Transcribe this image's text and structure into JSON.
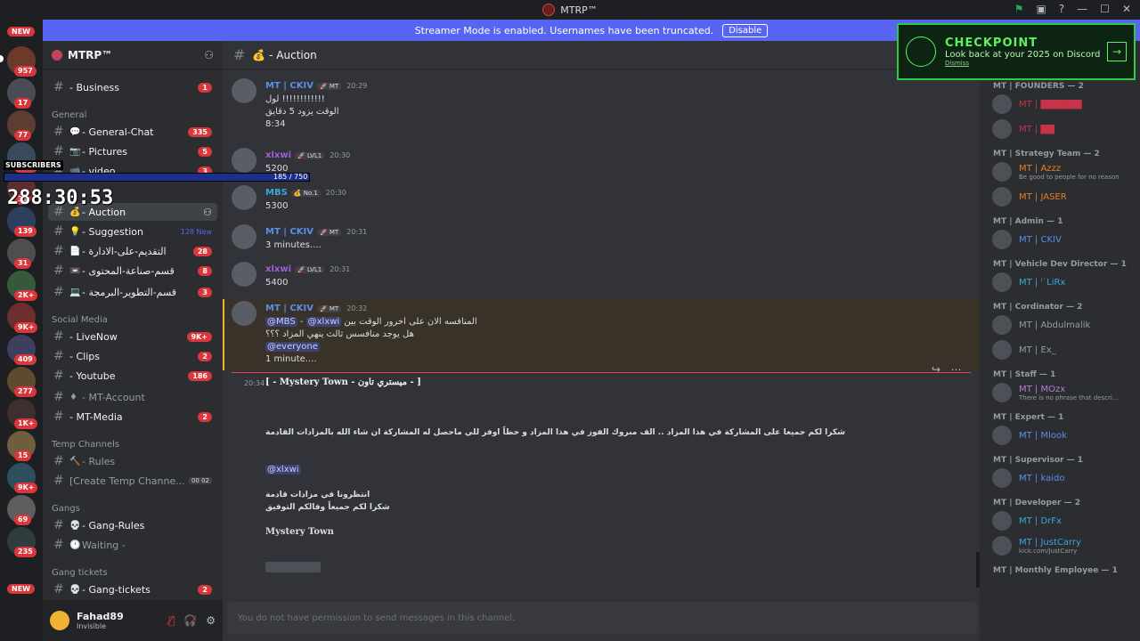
{
  "app_title": "MTRP™",
  "streamer_banner": {
    "text": "Streamer Mode is enabled. Usernames have been truncated.",
    "button": "Disable"
  },
  "server": {
    "name": "MTRP™"
  },
  "server_rail": {
    "top_new": "NEW",
    "badges": [
      "957",
      "17",
      "77",
      "1K+",
      "39",
      "139",
      "31",
      "2K+",
      "9K+",
      "409",
      "277",
      "1K+",
      "15",
      "9K+",
      "69",
      "235"
    ],
    "bottom_new": "NEW"
  },
  "categories": {
    "general": "General",
    "social": "Social Media",
    "temp": "Temp Channels",
    "gangs": "Gangs",
    "gang_tickets": "Gang tickets"
  },
  "channels": [
    {
      "name": "- Business",
      "badge": "1",
      "emoji": "",
      "bright": true
    },
    {
      "name": "- General-Chat",
      "badge": "335",
      "emoji": "💬",
      "bright": true
    },
    {
      "name": "- Pictures",
      "badge": "5",
      "emoji": "📷",
      "bright": true
    },
    {
      "name": "- video",
      "badge": "3",
      "emoji": "📹",
      "bright": true
    },
    {
      "name": "- Auction",
      "badge": "",
      "emoji": "💰",
      "active": true
    },
    {
      "name": "- Suggestion",
      "badge": "",
      "newtag": "128 New",
      "emoji": "💡",
      "bright": true
    },
    {
      "name": "- التقديم-على-الادارة",
      "badge": "28",
      "emoji": "📄",
      "bright": true
    },
    {
      "name": "- قسم-صناعة-المحتوى",
      "badge": "8",
      "emoji": "📼",
      "bright": true
    },
    {
      "name": "- قسم-التطوير-البرمجة",
      "badge": "3",
      "emoji": "💻",
      "bright": true
    },
    {
      "name": "- LiveNow",
      "badge": "9K+",
      "emoji": "",
      "bright": true
    },
    {
      "name": "- Clips",
      "badge": "2",
      "emoji": "",
      "bright": true
    },
    {
      "name": "- Youtube",
      "badge": "186",
      "emoji": "",
      "bright": true
    },
    {
      "name": "- MT-Account",
      "badge": "",
      "emoji": "♦",
      "bright": false
    },
    {
      "name": "- MT-Media",
      "badge": "2",
      "emoji": "",
      "bright": true
    },
    {
      "name": "- Rules",
      "badge": "",
      "emoji": "🔨",
      "bright": false
    },
    {
      "name": "[Create Temp Channe...",
      "badge": "",
      "emoji": "",
      "bright": false,
      "extra": "00 02"
    },
    {
      "name": "- Gang-Rules",
      "badge": "",
      "emoji": "💀",
      "bright": true
    },
    {
      "name": "Waiting -",
      "badge": "",
      "emoji": "🕐",
      "bright": false
    },
    {
      "name": "- Gang-tickets",
      "badge": "2",
      "emoji": "💀",
      "bright": true
    }
  ],
  "user": {
    "name": "Fahad89",
    "status": "Invisible"
  },
  "channel_header": {
    "name": "💰 - Auction"
  },
  "messages": [
    {
      "author": "MT | CKIV",
      "tag": "🚀 MT",
      "time": "20:29",
      "lines": [
        "لول !!!!!!!!!!!!",
        "الوقت يزود 5 دقايق",
        "8:34"
      ],
      "color": "#5c8ee8"
    },
    {
      "author": "xlxwi",
      "tag": "🚀 LVL1",
      "time": "20:30",
      "lines": [
        "5200"
      ],
      "color": "#a35ed8"
    },
    {
      "author": "MBS",
      "tag": "💰 No.1",
      "time": "20:30",
      "lines": [
        "5300"
      ],
      "color": "#3aa7d8"
    },
    {
      "author": "MT | CKIV",
      "tag": "🚀 MT",
      "time": "20:31",
      "lines": [
        "3 minutes...."
      ],
      "color": "#5c8ee8"
    },
    {
      "author": "xlxwi",
      "tag": "🚀 LVL1",
      "time": "20:31",
      "lines": [
        "5400"
      ],
      "color": "#a35ed8"
    },
    {
      "author": "MT | CKIV",
      "tag": "🚀 MT",
      "time": "20:32",
      "lines": [
        "المنافسه الان على اخرور الوقت بين",
        "هل يوجد منافسس ثالث ينهي المزاد ؟؟؟",
        "1 minute...."
      ],
      "mentions": [
        "@MBS",
        "@xlxwi",
        "@everyone"
      ],
      "color": "#5c8ee8"
    }
  ],
  "bot_message": {
    "time": "20:34",
    "title": "[ - Mystery Town - ميستري تاون - ]",
    "body": "شكرا لكم جميعا على المشاركة في هذا المزاد .. الف مبروك الفوز في هذا المزاد  و حظاً اوفر للي ماحصل له المشاركة ان شاء الله بالمزادات القادمة",
    "mention": "@xlxwi",
    "line1": "انتظرونا في مزادات قادمة",
    "line2": "شكرا لكم جميعاً وفالكم التوفيق",
    "sign": "Mystery Town"
  },
  "composer_placeholder": "You do not have permission to send messages in this channel.",
  "checkpoint": {
    "title": "CHECKPOINT",
    "subtitle": "Look back at your 2025 on Discord",
    "dismiss": "Dismiss"
  },
  "overlay": {
    "subscribers": "SUBSCRIBERS",
    "progress": "185 / 750",
    "timer": "288:30:53"
  },
  "member_groups": [
    {
      "title": "MT | FOUNDERS — 2",
      "members": [
        {
          "name": "MT | ██████",
          "color": "#c7344a"
        },
        {
          "name": "MT | ██",
          "color": "#c7344a"
        }
      ]
    },
    {
      "title": "MT | Strategy Team — 2",
      "members": [
        {
          "name": "MT | Azzz",
          "color": "#e67e22",
          "sub": "Be good to people for no reason"
        },
        {
          "name": "MT | JASER",
          "color": "#e67e22"
        }
      ]
    },
    {
      "title": "MT | Admin — 1",
      "members": [
        {
          "name": "MT | CKIV",
          "color": "#5c8ee8"
        }
      ]
    },
    {
      "title": "MT | Vehicle Dev Director — 1",
      "members": [
        {
          "name": "MT | ˡ˙LiRx",
          "color": "#3aa7d8"
        }
      ]
    },
    {
      "title": "MT | Cordinator — 2",
      "members": [
        {
          "name": "MT | Abdulmalik",
          "color": "#949ba4"
        },
        {
          "name": "MT | Ex_",
          "color": "#949ba4"
        }
      ]
    },
    {
      "title": "MT | Staff — 1",
      "members": [
        {
          "name": "MT | MOzx",
          "color": "#b77adb",
          "sub": "There is no phrase that descri..."
        }
      ]
    },
    {
      "title": "MT | Expert — 1",
      "members": [
        {
          "name": "MT | Mlook",
          "color": "#5c8ee8"
        }
      ]
    },
    {
      "title": "MT | Supervisor — 1",
      "members": [
        {
          "name": "MT | kaido",
          "color": "#5c8ee8"
        }
      ]
    },
    {
      "title": "MT | Developer — 2",
      "members": [
        {
          "name": "MT | DrFx",
          "color": "#3aa7d8"
        },
        {
          "name": "MT | JustCarry",
          "color": "#3aa7d8",
          "sub": "kick.com/JustCarry"
        }
      ]
    },
    {
      "title": "MT | Monthly Employee — 1",
      "members": []
    }
  ]
}
